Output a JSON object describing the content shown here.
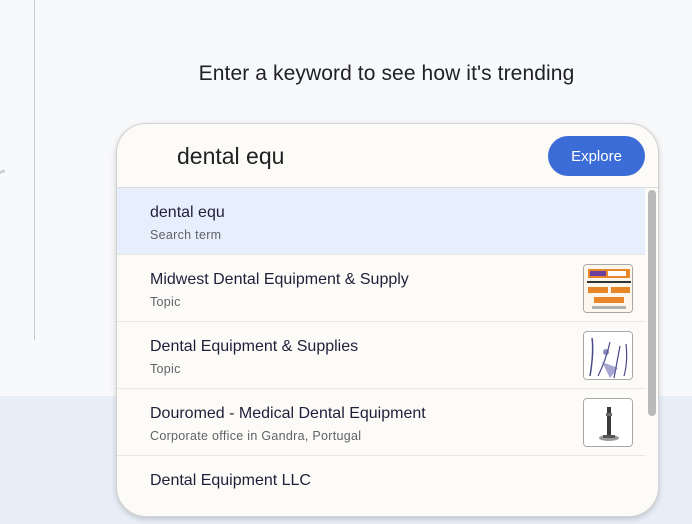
{
  "page": {
    "heading": "Enter a keyword to see how it's trending",
    "left_fragment": "r"
  },
  "search": {
    "value": "dental equ",
    "explore_label": "Explore"
  },
  "colors": {
    "explore_button": "#3c6cd7",
    "selected_row": "#e8effc",
    "bottom_band": "#e8eef7"
  },
  "suggestions": [
    {
      "title": "dental equ",
      "subtitle": "Search term",
      "thumbnail": null
    },
    {
      "title": "Midwest Dental Equipment & Supply",
      "subtitle": "Topic",
      "thumbnail": "midwest-dental-logo"
    },
    {
      "title": "Dental Equipment & Supplies",
      "subtitle": "Topic",
      "thumbnail": "dental-tools-sketch"
    },
    {
      "title": "Douromed - Medical Dental Equipment",
      "subtitle": "Corporate office in Gandra, Portugal",
      "thumbnail": "dental-instrument-photo"
    },
    {
      "title": "Dental Equipment LLC",
      "subtitle": "",
      "thumbnail": null
    }
  ]
}
